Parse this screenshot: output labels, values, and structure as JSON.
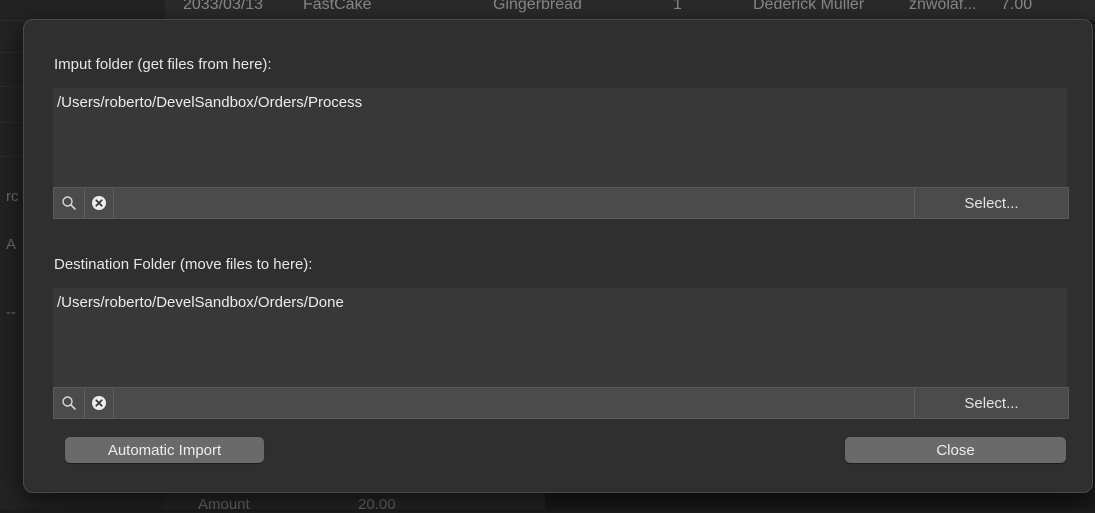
{
  "background": {
    "top_row": {
      "date": "2033/03/13",
      "company": "FastCake",
      "product": "Gingerbread",
      "qty": "1",
      "customer": "Dederick Muller",
      "email": "znwolaf...",
      "price": "7.00"
    },
    "bottom_row": {
      "label": "Amount",
      "value": "20.00"
    },
    "left_texts": [
      "rc",
      "A",
      "--"
    ]
  },
  "dialog": {
    "input_folder": {
      "label": "Imput folder (get files from here):",
      "path": "/Users/roberto/DevelSandbox/Orders/Process",
      "select_label": "Select..."
    },
    "destination_folder": {
      "label": "Destination Folder (move files to here):",
      "path": "/Users/roberto/DevelSandbox/Orders/Done",
      "select_label": "Select..."
    },
    "automatic_import_label": "Automatic Import",
    "close_label": "Close"
  },
  "icons": {
    "search": "search-icon",
    "clear": "clear-icon"
  },
  "colors": {
    "sheet_bg": "#2f2f2f",
    "field_bg": "#383838",
    "toolbar_bg": "#4b4b4b",
    "button_bg": "#6a6a6a",
    "text": "#e6e6e6"
  }
}
